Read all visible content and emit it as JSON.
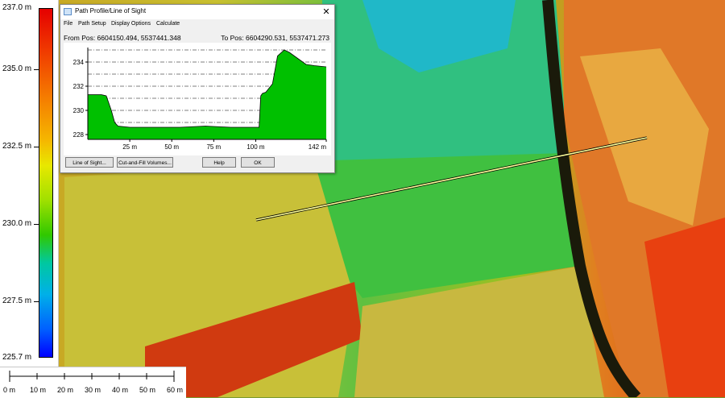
{
  "legend": {
    "labels": [
      "237.0 m",
      "235.0 m",
      "232.5 m",
      "230.0 m",
      "227.5 m",
      "225.7 m"
    ]
  },
  "scale_bar": {
    "labels": [
      "0 m",
      "10 m",
      "20 m",
      "30 m",
      "40 m",
      "50 m",
      "60 m"
    ]
  },
  "dialog": {
    "title": "Path Profile/Line of Sight",
    "close_label": "✕",
    "menu": [
      "File",
      "Path Setup",
      "Display Options",
      "Calculate"
    ],
    "from_pos": "From Pos: 6604150.494, 5537441.348",
    "to_pos": "To Pos: 6604290.531, 5537471.273",
    "buttons": {
      "line_of_sight": "Line of Sight...",
      "cut_fill": "Cut-and-Fill Volumes...",
      "help": "Help",
      "ok": "OK"
    }
  },
  "colors": {
    "profile_fill": "#00c000",
    "profile_line": "#000000",
    "path_line": "#ffff99"
  },
  "chart_data": {
    "type": "area",
    "x": [
      0,
      8,
      11,
      14,
      16,
      18,
      25,
      40,
      55,
      70,
      85,
      95,
      100,
      102,
      103,
      104,
      106,
      110,
      113,
      117,
      120,
      125,
      130,
      135,
      142
    ],
    "y": [
      231.3,
      231.3,
      231.2,
      230.0,
      229.0,
      228.7,
      228.6,
      228.6,
      228.6,
      228.7,
      228.6,
      228.6,
      228.6,
      228.6,
      231.2,
      231.4,
      231.5,
      232.2,
      234.5,
      235.0,
      234.8,
      234.3,
      233.8,
      233.7,
      233.6
    ],
    "x_ticks": [
      "25 m",
      "50 m",
      "75 m",
      "100 m",
      "142 m"
    ],
    "x_tick_values": [
      25,
      50,
      75,
      100,
      142
    ],
    "y_ticks": [
      "234",
      "232",
      "230",
      "228"
    ],
    "y_tick_values": [
      234,
      232,
      230,
      228
    ],
    "xlim": [
      0,
      142
    ],
    "ylim": [
      227.6,
      235.2
    ],
    "grid": true
  }
}
